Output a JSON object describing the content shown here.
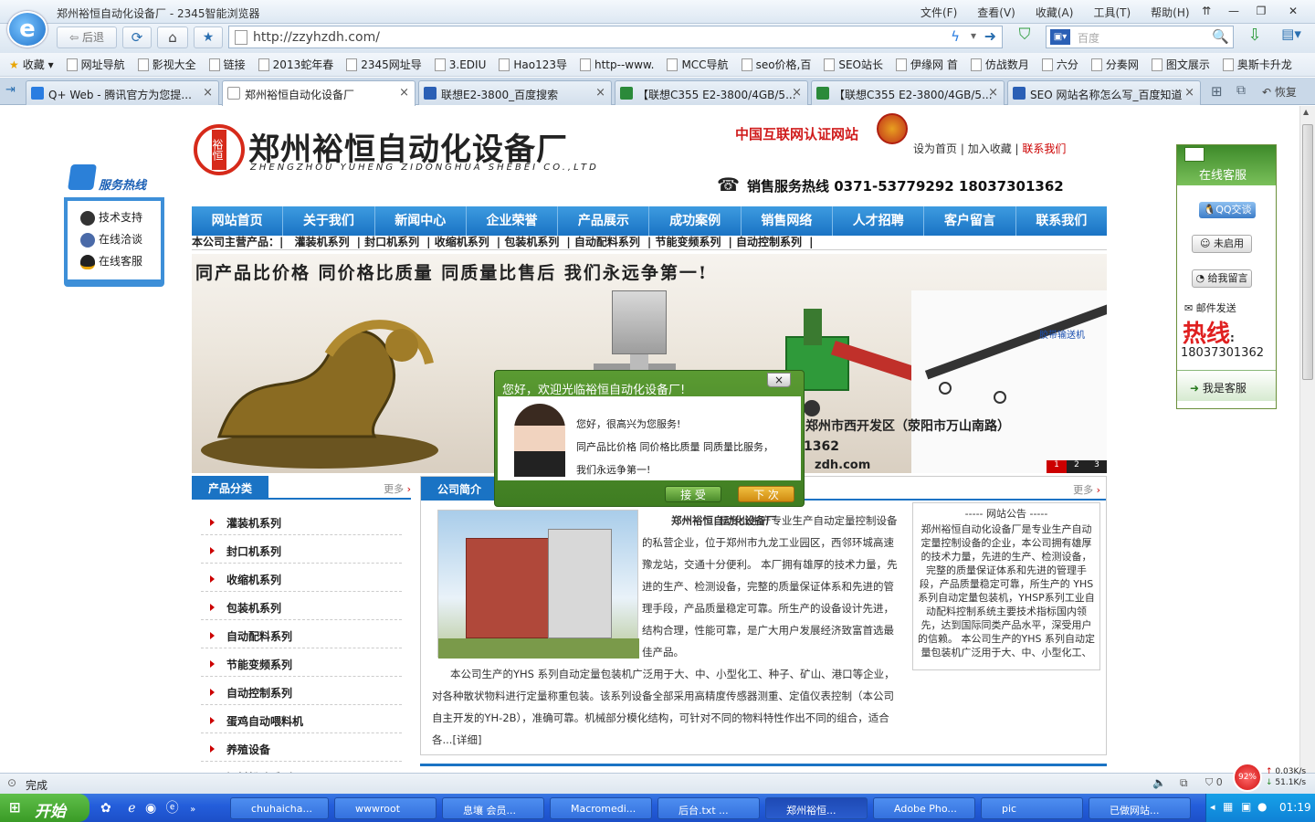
{
  "window": {
    "title": "郑州裕恒自动化设备厂 - 2345智能浏览器",
    "menus": [
      "文件(F)",
      "查看(V)",
      "收藏(A)",
      "工具(T)",
      "帮助(H)"
    ],
    "controls": [
      "⇈",
      "—",
      "❐",
      "✕"
    ]
  },
  "toolbar": {
    "browser_logo": "e",
    "back_label": "后退",
    "address": "http://zzyhzdh.com/",
    "search_placeholder": "百度"
  },
  "favorites": [
    "收藏",
    "网址导航",
    "影视大全",
    "链接",
    "2013蛇年春",
    "2345网址导",
    "3.EDIU",
    "Hao123导",
    "http--www.",
    "MCC导航",
    "seo价格,百",
    "SEO站长",
    "伊缘网 首",
    "仿战数月",
    "六分",
    "分奏网",
    "图文展示",
    "奥斯卡升龙"
  ],
  "tabs": [
    {
      "label": "Q+ Web - 腾讯官方为您提..."
    },
    {
      "label": "郑州裕恒自动化设备厂"
    },
    {
      "label": "联想E2-3800_百度搜索"
    },
    {
      "label": "【联想C355 E2-3800/4GB/5..."
    },
    {
      "label": "【联想C355 E2-3800/4GB/5..."
    },
    {
      "label": "SEO 网站名称怎么写_百度知道"
    }
  ],
  "tab_extra": {
    "restore": "恢复"
  },
  "site": {
    "logo_cn": "郑州裕恒自动化设备厂",
    "logo_en": "ZHENGZHOU YUHENG ZIDONGHUA SHEBEI CO.,LTD",
    "logo_badge": "裕恒",
    "cert": "中国互联网认证网站",
    "toplinks": [
      "设为首页",
      "加入收藏",
      "联系我们"
    ],
    "hotline": "销售服务热线  0371-53779292  18037301362",
    "nav": [
      "网站首页",
      "关于我们",
      "新闻中心",
      "企业荣誉",
      "产品展示",
      "成功案例",
      "销售网络",
      "人才招聘",
      "客户留言",
      "联系我们"
    ],
    "prod_prefix": "本公司主营产品：|",
    "products": [
      "灌装机系列",
      "封口机系列",
      "收缩机系列",
      "包装机系列",
      "自动配料系列",
      "节能变频系列",
      "自动控制系列"
    ],
    "slogan": "同产品比价格  同价格比质量  同质量比售后  我们永远争第一!",
    "banner_addr": "地址：郑州市西开发区（荥阳市万山南路）",
    "banner_tel": "1362",
    "banner_site": "zdh.com",
    "banner_tag": "胶带输送机",
    "banner_pages": [
      "1",
      "2",
      "3"
    ],
    "category_title": "产品分类",
    "more": "更多",
    "categories": [
      "灌装机系列",
      "封口机系列",
      "收缩机系列",
      "包装机系列",
      "自动配料系列",
      "节能变频系列",
      "自动控制系列",
      "蛋鸡自动喂料机",
      "养殖设备",
      "饲料粉碎系列"
    ],
    "intro_title": "公司简介",
    "intro_name": "郑州裕恒自动化设备厂",
    "intro_p1": "是专业生产专业生产自动定量控制设备的私营企业，位于郑州市九龙工业园区，西邻环城高速豫龙站，交通十分便利。  本厂拥有雄厚的技术力量，先进的生产、检测设备，完整的质量保证体系和先进的管理手段，产品质量稳定可靠。所生产的设备设计先进，结构合理，性能可靠，是广大用户发展经济致富首选最佳产品。",
    "intro_p2": "本公司生产的YHS 系列自动定量包装机广泛用于大、中、小型化工、种子、矿山、港口等企业，对各种散状物料进行定量称重包装。该系列设备全部采用高精度传感器测重、定值仪表控制（本公司自主开发的YH-2B），准确可靠。机械部分模化结构，可针对不同的物料特性作出不同的组合，适合各...",
    "intro_detail": "[详细]",
    "notice_title": "----- 网站公告 -----",
    "notice_text": "郑州裕恒自动化设备厂是专业生产自动定量控制设备的企业，本公司拥有雄厚的技术力量，先进的生产、检测设备，完整的质量保证体系和先进的管理手段，产品质量稳定可靠，所生产的 YHS系列自动定量包装机，YHSP系列工业自动配料控制系统主要技术指标国内领先，达到国际同类产品水平，深受用户的信赖。  本公司生产的YHS 系列自动定量包装机广泛用于大、中、小型化工、"
  },
  "float_left": {
    "title": "服务热线",
    "items": [
      "技术支持",
      "在线洽谈",
      "在线客服"
    ]
  },
  "float_right": {
    "title": "在线客服",
    "qq_btn": "QQ交谈",
    "disabled_btn": "未启用",
    "msg_btn": "给我留言",
    "mail": "邮件发送",
    "hot": "热线",
    "colon": ":",
    "phone": "18037301362",
    "me": "我是客服"
  },
  "popup": {
    "title": "您好，欢迎光临裕恒自动化设备厂!",
    "lines": [
      "您好，很高兴为您服务!",
      "同产品比价格  同价格比质量  同质量比服务，",
      "我们永远争第一!"
    ],
    "accept": "接 受",
    "next": "下 次"
  },
  "status": {
    "text": "完成",
    "percent": "92%",
    "up": "0.03K/s",
    "down": "51.1K/s",
    "badge_count": "0"
  },
  "taskbar": {
    "start": "开始",
    "tasks": [
      "chuhaicha...",
      "wwwroot",
      "息壤 会员...",
      "Macromedi...",
      "后台.txt ...",
      "郑州裕恒...",
      "Adobe Pho...",
      "pic",
      "已做网站..."
    ],
    "clock": "01:19"
  },
  "colors": {
    "nav_blue": "#1a73c4",
    "popup_green": "#4a8a2a",
    "accent_red": "#cc0000"
  }
}
